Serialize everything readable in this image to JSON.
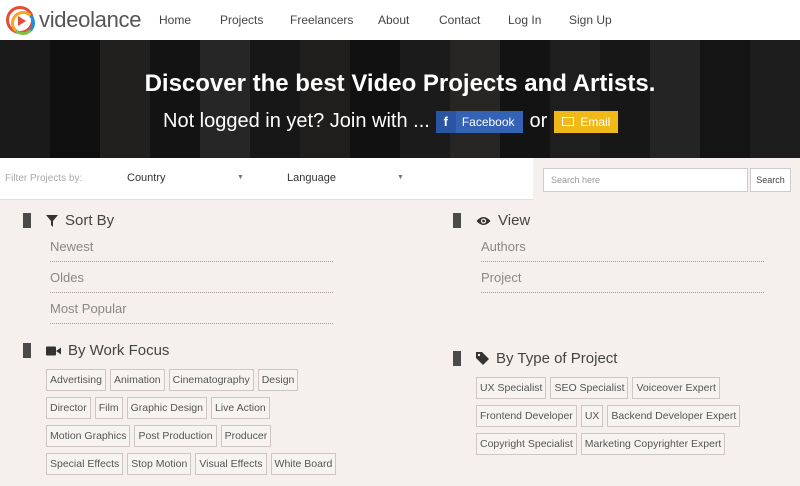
{
  "brand": {
    "name": "videolance",
    "icon": "videolance-logo-icon"
  },
  "nav": {
    "items": [
      {
        "label": "Home"
      },
      {
        "label": "Projects"
      },
      {
        "label": "Freelancers"
      },
      {
        "label": "About"
      },
      {
        "label": "Contact"
      },
      {
        "label": "Log In"
      },
      {
        "label": "Sign Up"
      }
    ]
  },
  "hero": {
    "title": "Discover the best Video Projects and Artists.",
    "subtitle": "Not logged in yet? Join with ...",
    "facebook_label": "Facebook",
    "or_text": "or",
    "email_label": "Email",
    "colors": {
      "facebook": "#3462b5",
      "email": "#f0b818"
    }
  },
  "filter": {
    "label": "Filter Projects by:",
    "country": "Country",
    "language": "Language",
    "search_placeholder": "Search here",
    "search_button": "Search"
  },
  "sort_by": {
    "title": "Sort By",
    "icon": "filter-icon",
    "options": [
      "Newest",
      "Oldes",
      "Most Popular"
    ]
  },
  "view": {
    "title": "View",
    "icon": "eye-icon",
    "options": [
      "Authors",
      "Project"
    ]
  },
  "work_focus": {
    "title": "By Work Focus",
    "icon": "video-camera-icon",
    "tags": [
      "Advertising",
      "Animation",
      "Cinematography",
      "Design",
      "Director",
      "Film",
      "Graphic Design",
      "Live Action",
      "Motion Graphics",
      "Post Production",
      "Producer",
      "Special Effects",
      "Stop Motion",
      "Visual Effects",
      "White Board"
    ]
  },
  "project_type": {
    "title": "By Type of Project",
    "icon": "tag-icon",
    "tags": [
      "UX Specialist",
      "SEO Specialist",
      "Voiceover Expert",
      "Frontend Developer",
      "UX",
      "Backend Developer Expert",
      "Copyright Specialist",
      "Marketing Copyrighter Expert"
    ]
  }
}
